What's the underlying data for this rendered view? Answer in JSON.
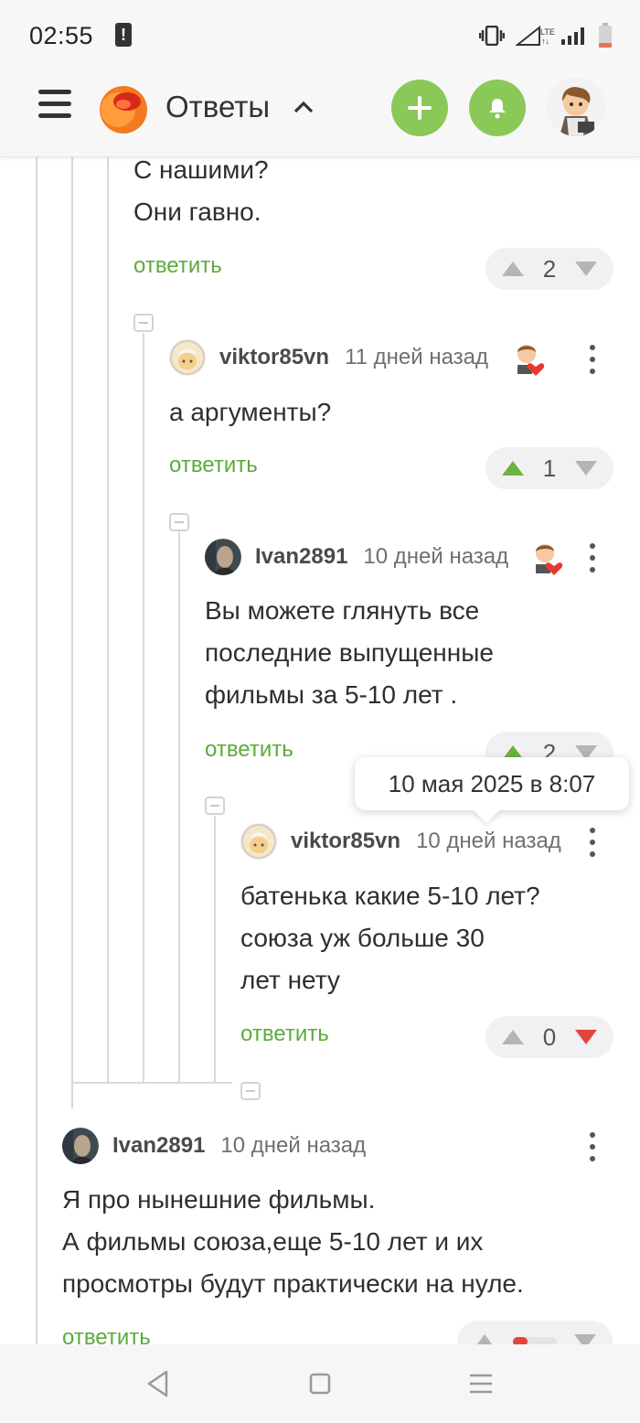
{
  "status": {
    "time": "02:55",
    "alert_glyph": "!",
    "network": "LTE"
  },
  "header": {
    "title": "Ответы"
  },
  "top_comment": {
    "lines": [
      "С нашими?",
      "Они гавно."
    ],
    "reply": "ответить",
    "score": "2"
  },
  "comment1": {
    "user": "viktor85vn",
    "time": "11 дней назад",
    "text": "а аргументы?",
    "reply": "ответить",
    "score": "1"
  },
  "comment2": {
    "user": "Ivan2891",
    "time": "10 дней назад",
    "lines": [
      "Вы можете глянуть все",
      "последние выпущенные",
      "фильмы за 5-10 лет ."
    ],
    "reply": "ответить",
    "score": "2"
  },
  "tooltip": {
    "text": "10 мая 2025 в 8:07"
  },
  "comment3": {
    "user": "viktor85vn",
    "time": "10 дней назад",
    "lines": [
      "батенька какие 5-10 лет?",
      "союза уж больше 30",
      "лет нету"
    ],
    "reply": "ответить",
    "score": "0"
  },
  "comment4": {
    "user": "Ivan2891",
    "time": "10 дней назад",
    "lines": [
      "Я про нынешние фильмы.",
      "А фильмы союза,еще 5-10 лет и их",
      "просмотры будут практически на нуле."
    ],
    "reply": "ответить"
  },
  "colors": {
    "accent_green": "#8ac858",
    "link_green": "#5bab3a",
    "downvote_red": "#e2453b",
    "upvote_green": "#6cb33f"
  }
}
